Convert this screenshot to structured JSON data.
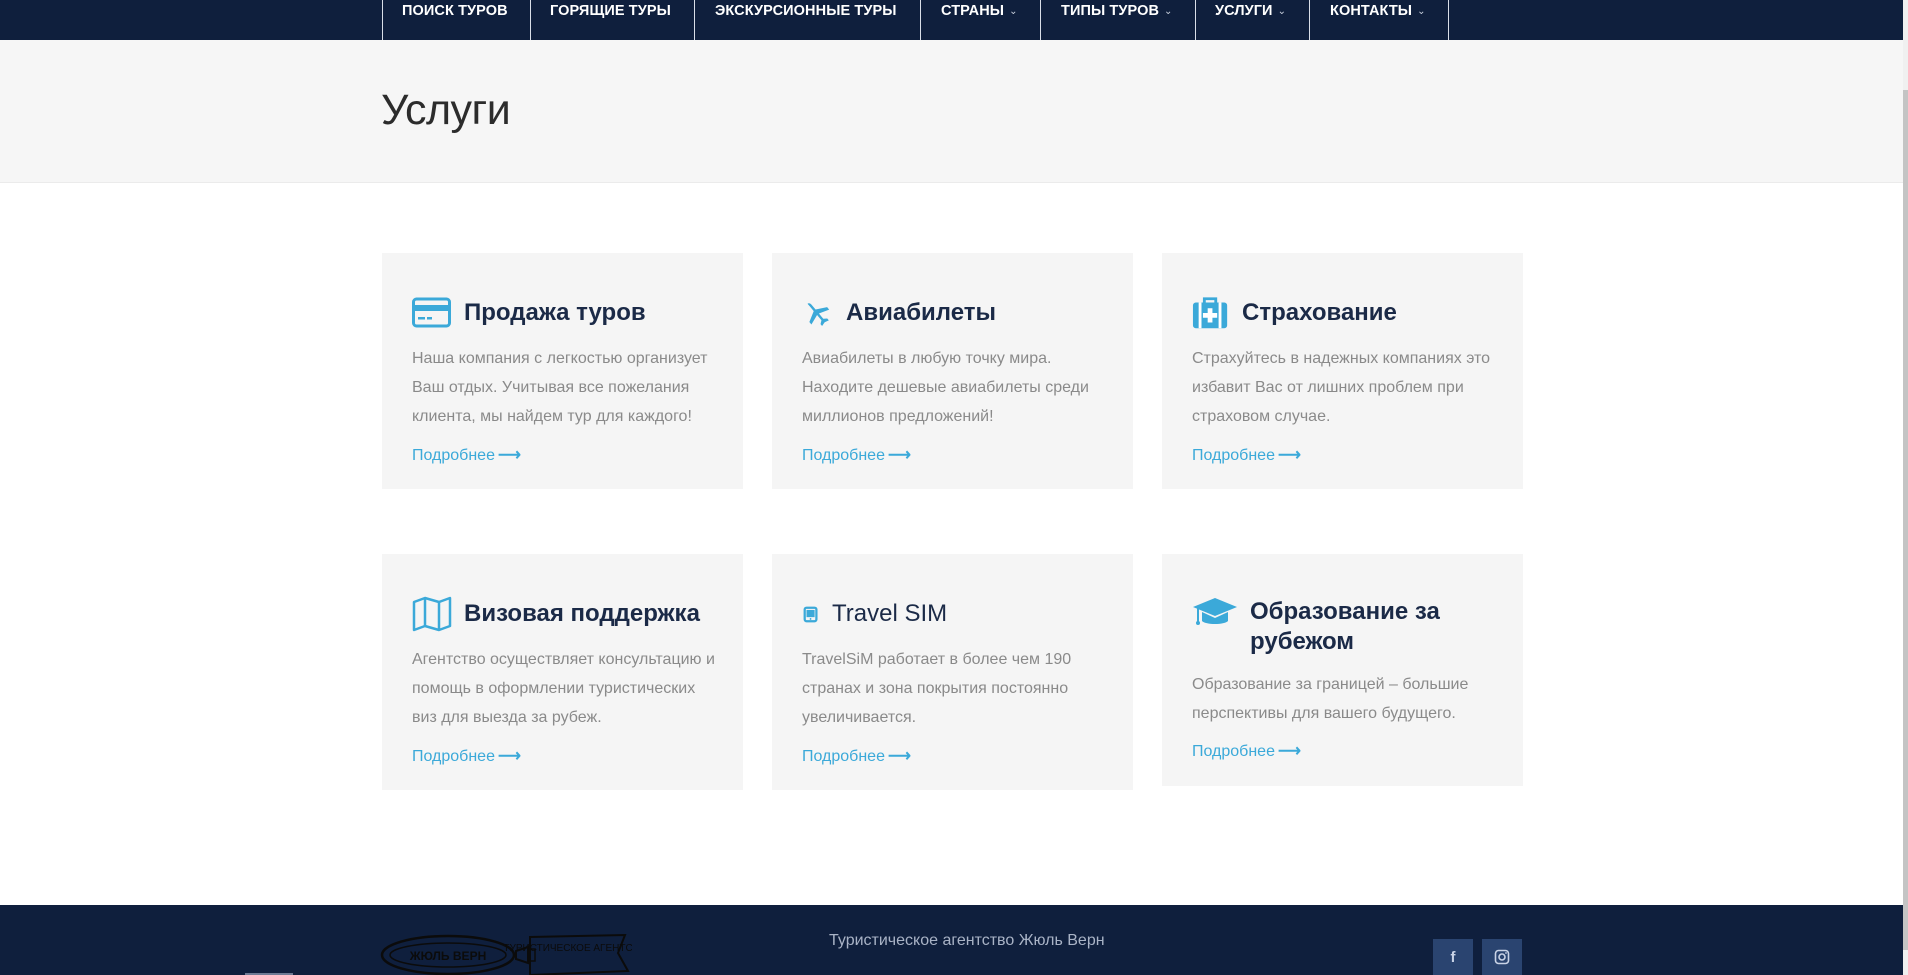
{
  "nav": {
    "items": [
      {
        "label": "ПОИСК ТУРОВ",
        "has_caret": false
      },
      {
        "label": "ГОРЯЩИЕ ТУРЫ",
        "has_caret": false
      },
      {
        "label": "ЭКСКУРСИОННЫЕ ТУРЫ",
        "has_caret": false
      },
      {
        "label": "СТРАНЫ",
        "has_caret": true
      },
      {
        "label": "ТИПЫ ТУРОВ",
        "has_caret": true
      },
      {
        "label": "УСЛУГИ",
        "has_caret": true
      },
      {
        "label": "КОНТАКТЫ",
        "has_caret": true
      }
    ],
    "caret_glyph": "⌄"
  },
  "page": {
    "title": "Услуги"
  },
  "services": [
    {
      "icon": "credit-card-icon",
      "title": "Продажа туров",
      "text": "Наша компания с легкостью организует Ваш отдых. Учитывая все пожелания клиента, мы найдем тур для каждого!",
      "link": "Подробнее"
    },
    {
      "icon": "airplane-icon",
      "title": "Авиабилеты",
      "text": "Авиабилеты в любую точку мира. Находите дешевые авиабилеты среди миллионов предложений!",
      "link": "Подробнее"
    },
    {
      "icon": "medical-kit-icon",
      "title": "Страхование",
      "text": "Страхуйтесь в надежных компаниях это избавит Вас от лишних проблем при страховом случае.",
      "link": "Подробнее"
    },
    {
      "icon": "map-icon",
      "title": "Визовая поддержка",
      "text": "Агентство осуществляет консультацию и помощь в оформлении туристических виз для выезда за рубеж.",
      "link": "Подробнее"
    },
    {
      "icon": "mobile-phone-icon",
      "title": "Travel SIM",
      "text": "TravelSiM работает в более чем 190 странах и зона покрытия постоянно увеличивается.",
      "link": "Подробнее"
    },
    {
      "icon": "graduation-cap-icon",
      "title": "Образование за рубежом",
      "text": "Образование за границей – большие перспективы для вашего будущего.",
      "link": "Подробнее"
    }
  ],
  "link_arrow": "⟶",
  "footer": {
    "logo": {
      "wordmark": "ЖЮЛЬ ВЕРН",
      "banner": "ТУРИСТИЧЕСКОЕ АГЕНТСТВО"
    },
    "text": "Туристическое агентство Жюль Верн",
    "social": [
      {
        "icon": "facebook-icon",
        "glyph": "f"
      },
      {
        "icon": "instagram-icon",
        "glyph": ""
      }
    ]
  },
  "colors": {
    "nav_bg": "#0f1f3d",
    "accent": "#3ba9d9",
    "card_bg": "#f5f5f5",
    "title_text": "#1b2a47",
    "body_text": "#8a8a8a"
  }
}
